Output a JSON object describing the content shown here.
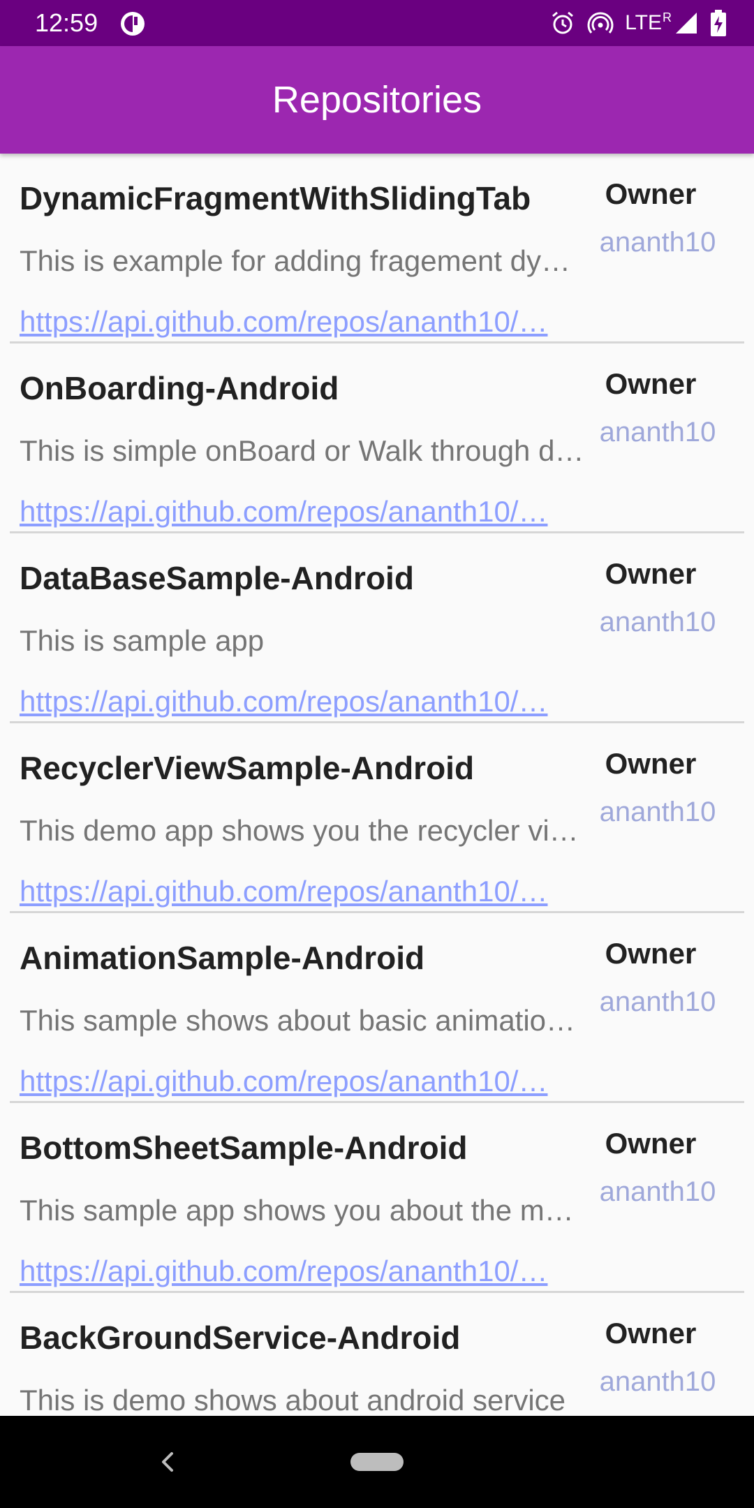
{
  "status_bar": {
    "time": "12:59",
    "network": "LTE",
    "roaming": "R",
    "icons": [
      "circle-half-icon",
      "alarm-icon",
      "hotspot-icon",
      "signal-icon",
      "battery-charging-icon"
    ],
    "bg_color": "#6A0080"
  },
  "app_bar": {
    "title": "Repositories",
    "bg_color": "#9C27B0"
  },
  "repos": [
    {
      "name": "DynamicFragmentWithSlidingTab",
      "description": "This is example for adding fragement dy…",
      "url": "https://api.github.com/repos/ananth10/…",
      "owner_label": "Owner",
      "owner": "ananth10"
    },
    {
      "name": "OnBoarding-Android",
      "description": "This is simple onBoard or Walk through d…",
      "url": "https://api.github.com/repos/ananth10/…",
      "owner_label": "Owner",
      "owner": "ananth10"
    },
    {
      "name": "DataBaseSample-Android",
      "description": "This is sample app",
      "url": "https://api.github.com/repos/ananth10/…",
      "owner_label": "Owner",
      "owner": "ananth10"
    },
    {
      "name": "RecyclerViewSample-Android",
      "description": "This demo app shows you the recycler vi…",
      "url": "https://api.github.com/repos/ananth10/…",
      "owner_label": "Owner",
      "owner": "ananth10"
    },
    {
      "name": "AnimationSample-Android",
      "description": "This sample shows about basic animatio…",
      "url": "https://api.github.com/repos/ananth10/…",
      "owner_label": "Owner",
      "owner": "ananth10"
    },
    {
      "name": "BottomSheetSample-Android",
      "description": "This sample app shows you about the m…",
      "url": "https://api.github.com/repos/ananth10/…",
      "owner_label": "Owner",
      "owner": "ananth10"
    },
    {
      "name": "BackGroundService-Android",
      "description": "This is demo shows about android service",
      "url": "",
      "owner_label": "Owner",
      "owner": "ananth10"
    }
  ],
  "nav_bar": {
    "icons": [
      "back-icon",
      "home-pill-icon"
    ]
  },
  "colors": {
    "owner_name": "#9FA8DA",
    "url": "#8C9EFF",
    "divider": "#D6D6D6"
  }
}
